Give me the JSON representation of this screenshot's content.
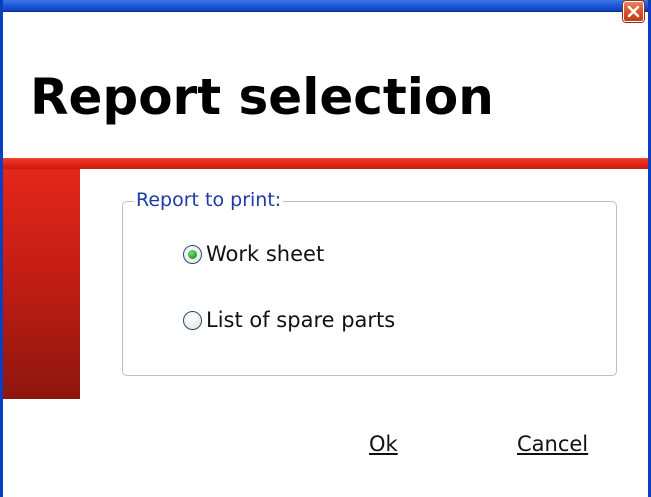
{
  "window": {
    "title": "Report selection",
    "close_icon": "close-icon"
  },
  "report_group": {
    "legend": "Report to print:",
    "options": [
      {
        "label": "Work sheet",
        "checked": true
      },
      {
        "label": "List of spare parts",
        "checked": false
      }
    ]
  },
  "buttons": {
    "ok_label": "Ok",
    "cancel_label": "Cancel"
  },
  "colors": {
    "titlebar": "#1f5bd8",
    "accent_red": "#e02416",
    "legend_text": "#1c3aa8",
    "radio_selected": "#2aa82a"
  }
}
